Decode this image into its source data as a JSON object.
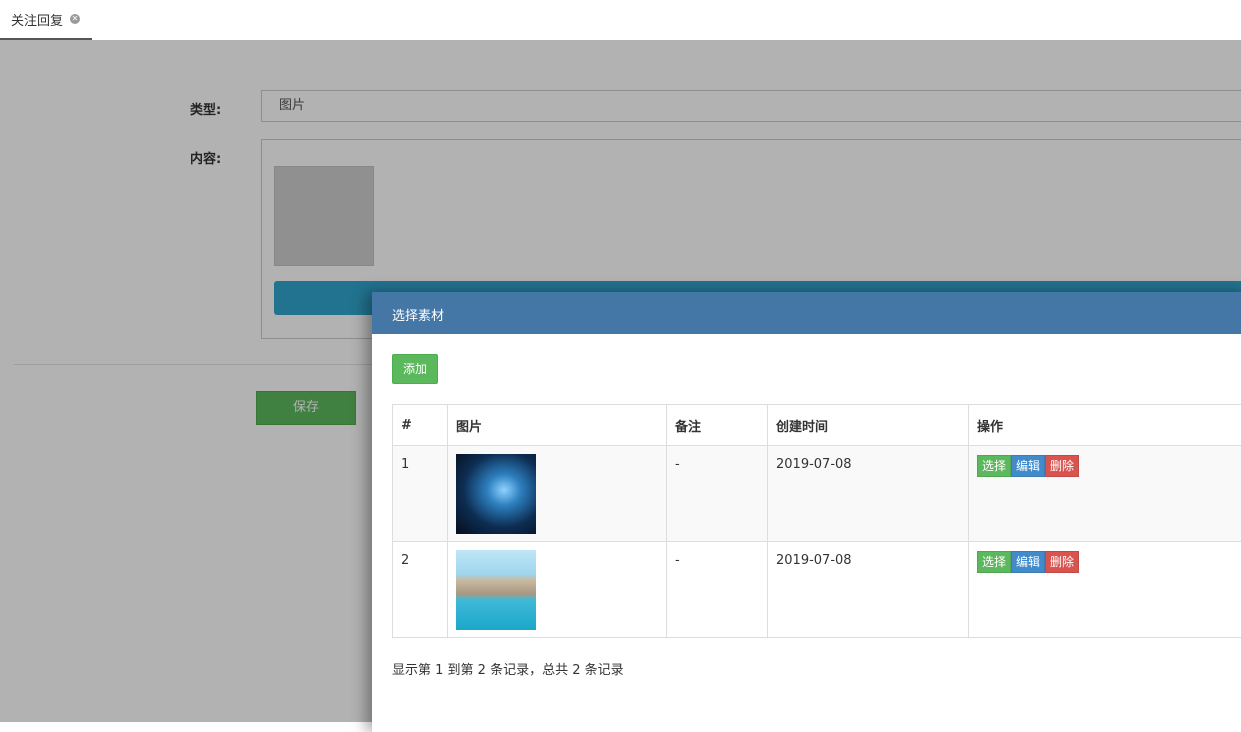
{
  "tab": {
    "label": "关注回复"
  },
  "form": {
    "type_label": "类型:",
    "type_value": "图片",
    "content_label": "内容:",
    "save_label": "保存"
  },
  "modal": {
    "title": "选择素材",
    "add_label": "添加",
    "columns": [
      "#",
      "图片",
      "备注",
      "创建时间",
      "操作"
    ],
    "rows": [
      {
        "index": "1",
        "image": "space-nebula-image",
        "note": "-",
        "created": "2019-07-08"
      },
      {
        "index": "2",
        "image": "sea-arch-coast-image",
        "note": "-",
        "created": "2019-07-08"
      }
    ],
    "actions": {
      "select": "选择",
      "edit": "编辑",
      "delete": "删除"
    },
    "pagination_info": "显示第 1 到第 2 条记录，总共 2 条记录"
  },
  "colors": {
    "modal_header": "#4577a6",
    "success": "#5cb85c",
    "primary": "#428bca",
    "danger": "#d9534f",
    "upload_bar": "#31a5cf"
  }
}
